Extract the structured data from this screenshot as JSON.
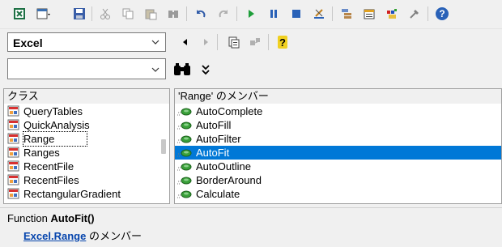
{
  "toolbar": {
    "icons": [
      "excel-icon",
      "view-object-icon",
      "save-icon",
      "cut-icon",
      "copy-icon",
      "paste-icon",
      "find-icon",
      "undo-icon",
      "redo-icon",
      "run-icon",
      "break-icon",
      "reset-icon",
      "design-mode-icon",
      "project-explorer-icon",
      "properties-icon",
      "object-browser-icon",
      "toolbox-icon",
      "help-icon"
    ]
  },
  "library_combo": {
    "value": "Excel"
  },
  "search_combo": {
    "value": ""
  },
  "classes": {
    "header": "クラス",
    "items": [
      {
        "label": "QueryTables"
      },
      {
        "label": "QuickAnalysis"
      },
      {
        "label": "Range"
      },
      {
        "label": "Ranges"
      },
      {
        "label": "RecentFile"
      },
      {
        "label": "RecentFiles"
      },
      {
        "label": "RectangularGradient"
      }
    ]
  },
  "members": {
    "header": "'Range' のメンバー",
    "items": [
      {
        "label": "AutoComplete"
      },
      {
        "label": "AutoFill"
      },
      {
        "label": "AutoFilter"
      },
      {
        "label": "AutoFit"
      },
      {
        "label": "AutoOutline"
      },
      {
        "label": "BorderAround"
      },
      {
        "label": "Calculate"
      }
    ]
  },
  "details": {
    "prefix": "Function ",
    "name": "AutoFit()",
    "link_library": "Excel",
    "dot": ".",
    "link_class": "Range",
    "suffix": " のメンバー"
  }
}
